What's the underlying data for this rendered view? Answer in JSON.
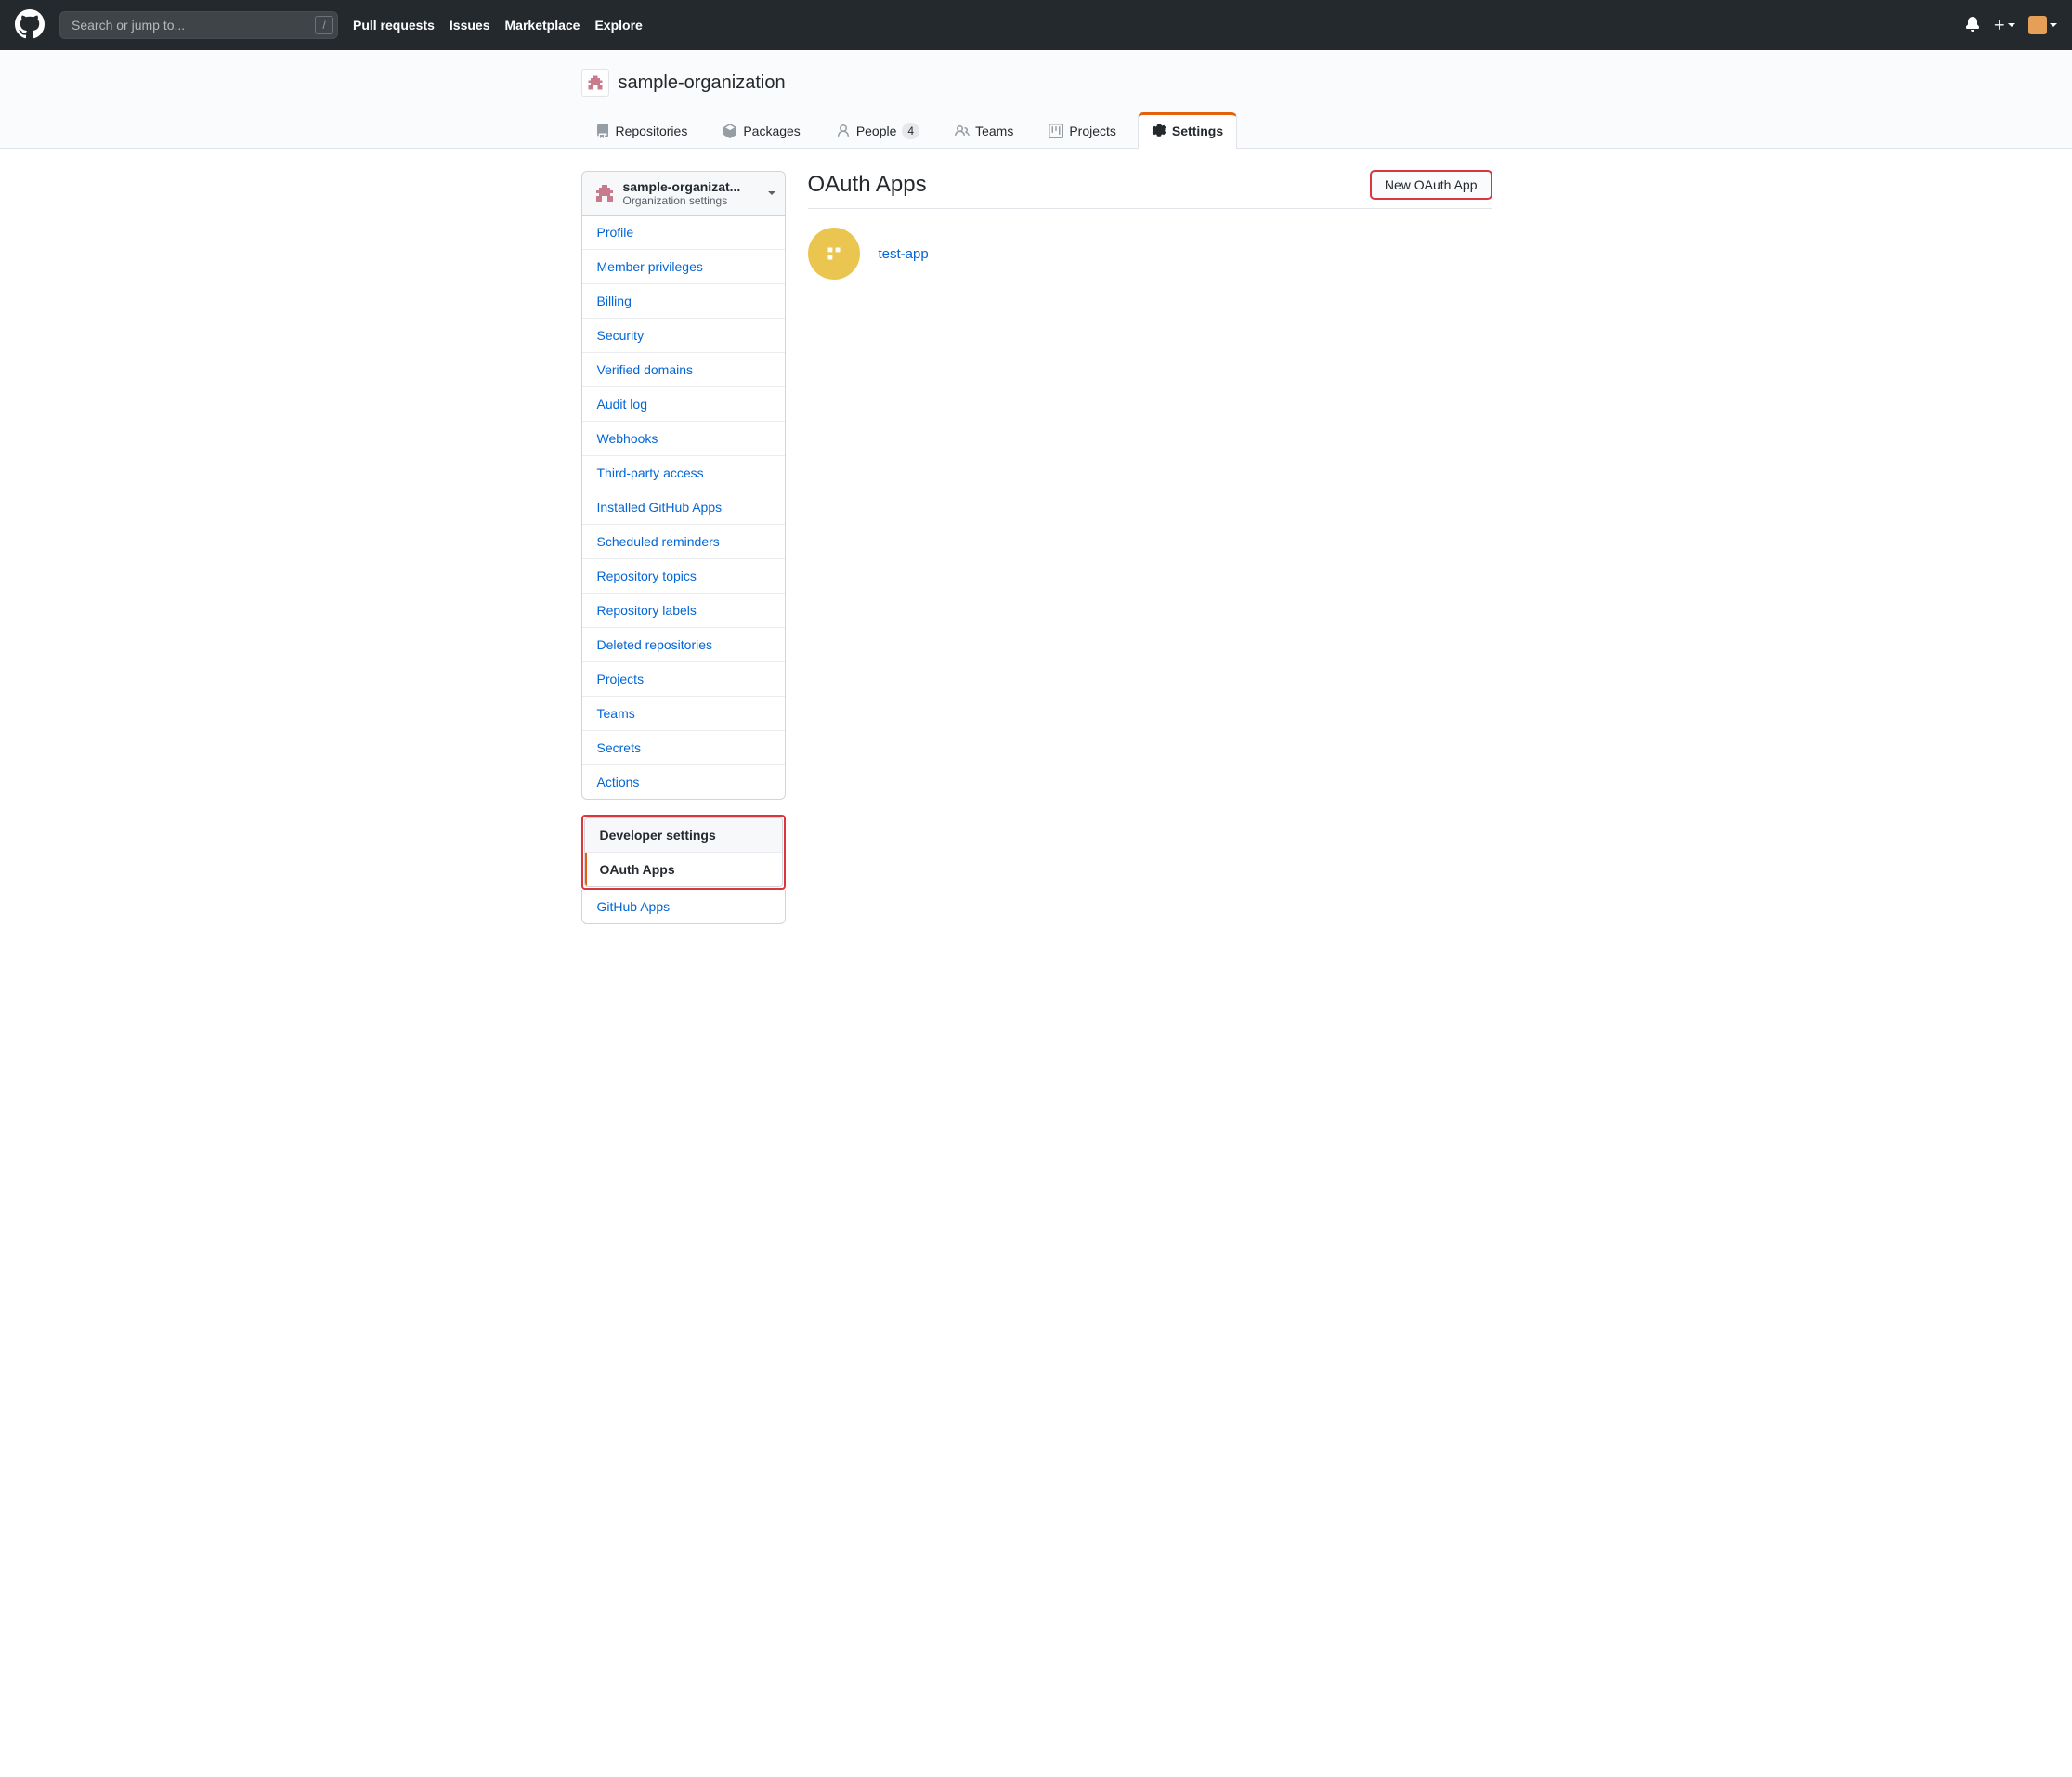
{
  "topbar": {
    "search_placeholder": "Search or jump to...",
    "nav": {
      "pull_requests": "Pull requests",
      "issues": "Issues",
      "marketplace": "Marketplace",
      "explore": "Explore"
    }
  },
  "org": {
    "name": "sample-organization",
    "tabs": {
      "repositories": "Repositories",
      "packages": "Packages",
      "people": "People",
      "people_count": "4",
      "teams": "Teams",
      "projects": "Projects",
      "settings": "Settings"
    }
  },
  "context": {
    "title": "sample-organizat...",
    "subtitle": "Organization settings"
  },
  "menu": {
    "profile": "Profile",
    "member_privileges": "Member privileges",
    "billing": "Billing",
    "security": "Security",
    "verified_domains": "Verified domains",
    "audit_log": "Audit log",
    "webhooks": "Webhooks",
    "third_party": "Third-party access",
    "installed_apps": "Installed GitHub Apps",
    "scheduled_reminders": "Scheduled reminders",
    "repo_topics": "Repository topics",
    "repo_labels": "Repository labels",
    "deleted_repos": "Deleted repositories",
    "projects": "Projects",
    "teams": "Teams",
    "secrets": "Secrets",
    "actions": "Actions"
  },
  "dev_settings": {
    "heading": "Developer settings",
    "oauth_apps": "OAuth Apps",
    "github_apps": "GitHub Apps"
  },
  "page": {
    "title": "OAuth Apps",
    "new_button": "New OAuth App"
  },
  "apps": [
    {
      "name": "test-app"
    }
  ]
}
